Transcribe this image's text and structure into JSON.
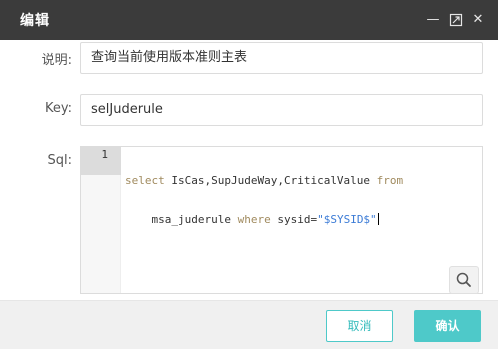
{
  "window": {
    "title": "编辑",
    "minimize_glyph": "—",
    "maximize_icon": "restore-icon",
    "close_glyph": "✕"
  },
  "form": {
    "description": {
      "label": "说明:",
      "value": "查询当前使用版本准则主表"
    },
    "key": {
      "label": "Key:",
      "value": "selJuderule"
    },
    "sql": {
      "label": "Sql:",
      "line_number": "1",
      "line1_tokens": [
        {
          "t": "select",
          "c": "kw"
        },
        {
          "t": " IsCas,SupJudeWay,CriticalValue "
        },
        {
          "t": "from",
          "c": "kw"
        }
      ],
      "line2_tokens": [
        {
          "t": "    msa_juderule "
        },
        {
          "t": "where",
          "c": "kw"
        },
        {
          "t": " sysid="
        },
        {
          "t": "\"$SYSID$\"",
          "c": "str"
        }
      ]
    },
    "search_icon": "magnifier-icon"
  },
  "footer": {
    "cancel_label": "取消",
    "ok_label": "确认"
  },
  "colors": {
    "titlebar": "#3b3b3b",
    "accent": "#4ec9c9",
    "keyword": "#a08a5e",
    "string": "#3b7bd6"
  }
}
